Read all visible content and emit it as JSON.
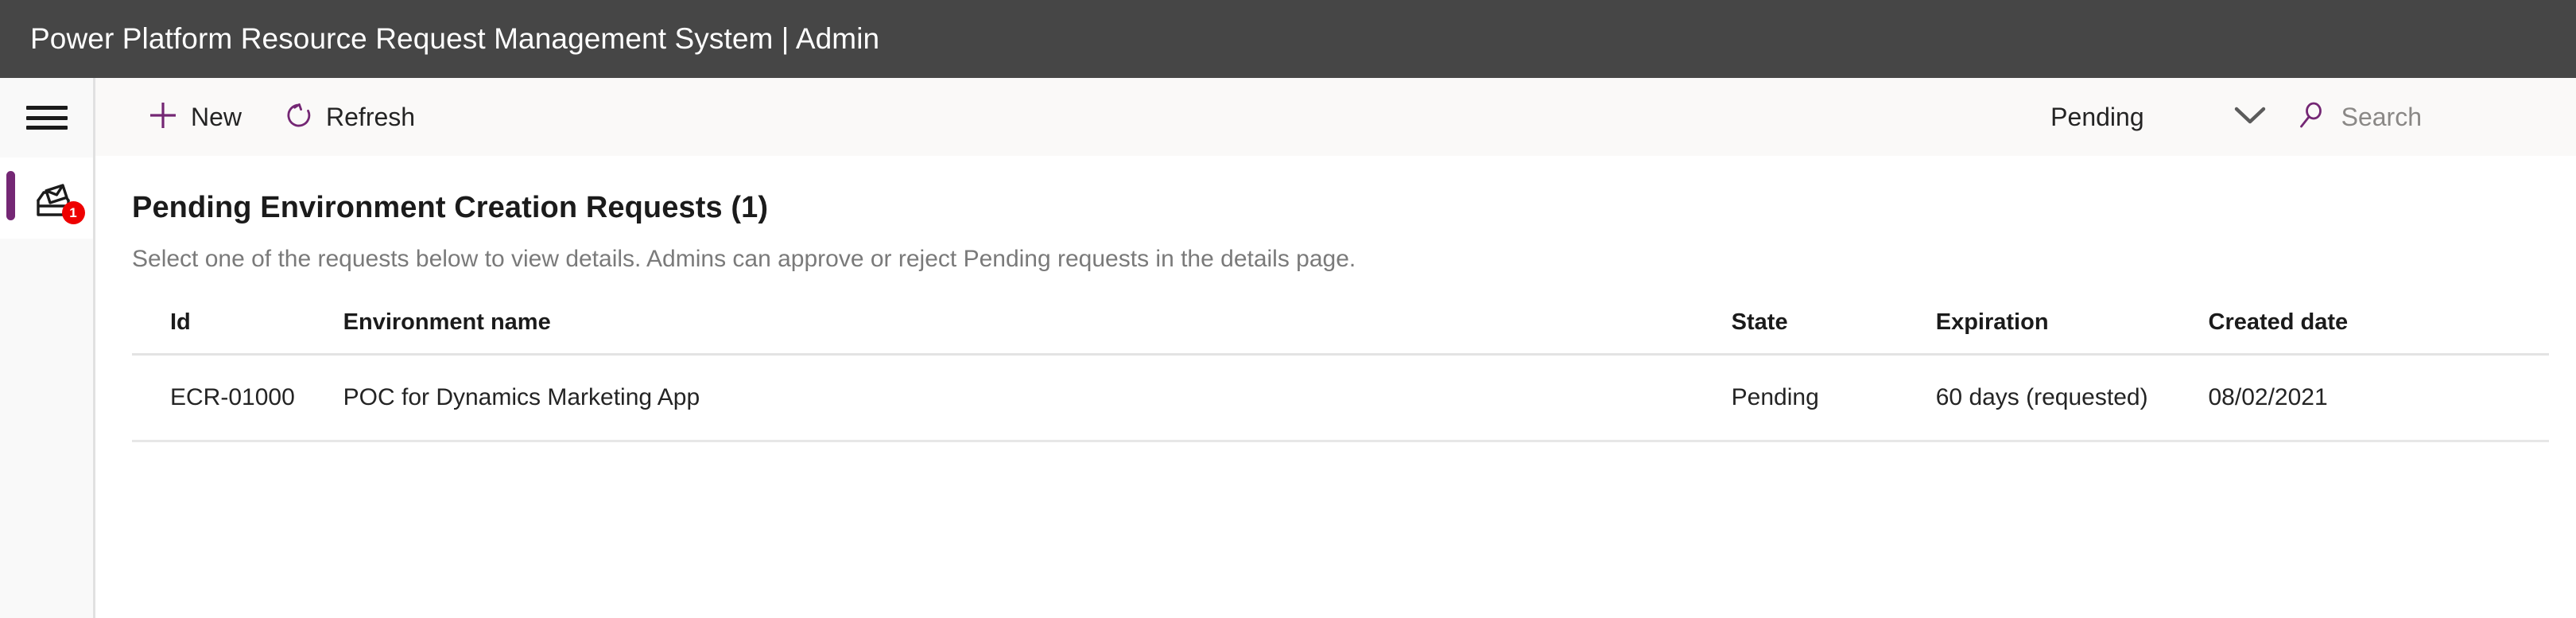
{
  "titlebar": {
    "title": "Power Platform Resource Request Management System | Admin",
    "background": "#464646",
    "text_color": "#ffffff"
  },
  "rail": {
    "hamburger_label": "Menu",
    "items": [
      {
        "icon": "inbox-icon",
        "badge_count": "1",
        "selected": true,
        "accent": "#742774",
        "badge_color": "#ee0000"
      }
    ]
  },
  "commandbar": {
    "new_label": "New",
    "refresh_label": "Refresh",
    "filter_value": "Pending",
    "search_placeholder": "Search",
    "accent": "#742774",
    "background": "#faf9f8"
  },
  "content": {
    "page_title": "Pending Environment Creation Requests (1)",
    "page_subtitle": "Select one of the requests below to view details. Admins can approve or reject Pending requests in the details page.",
    "table": {
      "columns": [
        "Id",
        "Environment name",
        "State",
        "Expiration",
        "Created date"
      ],
      "rows": [
        {
          "id": "ECR-01000",
          "environment_name": "POC for Dynamics Marketing App",
          "state": "Pending",
          "expiration": "60 days (requested)",
          "created_date": "08/02/2021"
        }
      ]
    }
  }
}
